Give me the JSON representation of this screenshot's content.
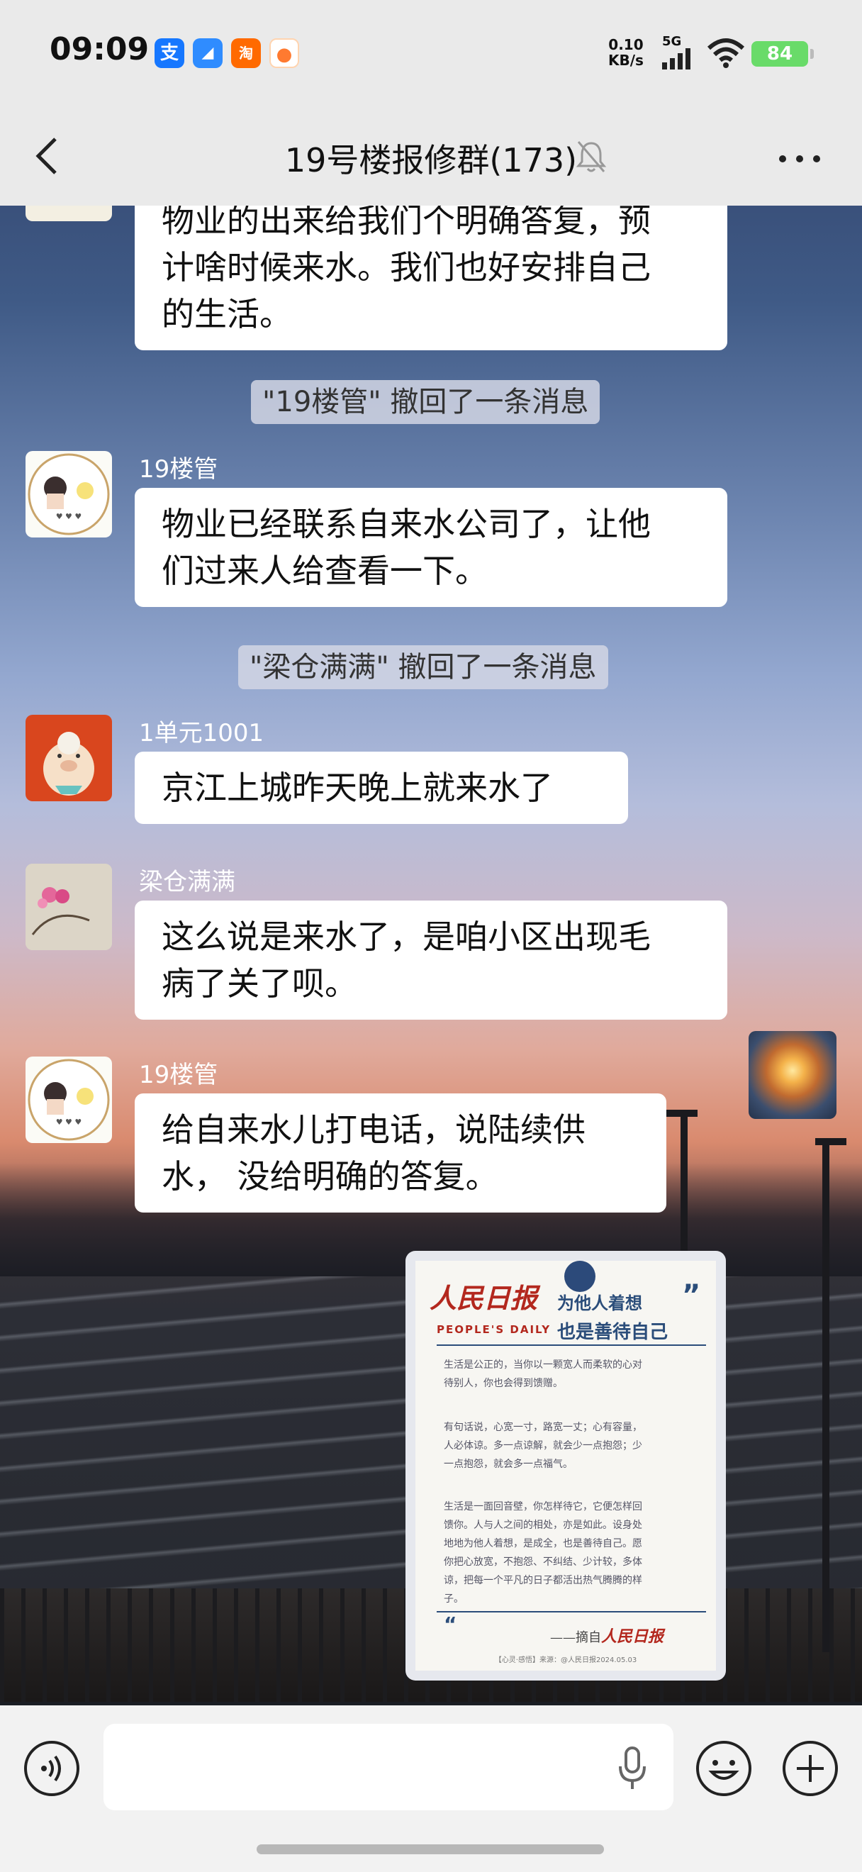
{
  "status_bar": {
    "time": "09:09",
    "net_speed_value": "0.10",
    "net_speed_unit": "KB/s",
    "network": "5G",
    "battery": "84",
    "apps": [
      {
        "icon": "alipay-icon",
        "glyph": "支",
        "color": "#1677ff"
      },
      {
        "icon": "browser-icon",
        "glyph": "◢",
        "color": "#2f8cff"
      },
      {
        "icon": "taobao-flash-icon",
        "glyph": "淘",
        "color": "#ff6a00"
      },
      {
        "icon": "game-app-icon",
        "glyph": "●",
        "color": "#ff7a30"
      }
    ]
  },
  "header": {
    "title": "19号楼报修群(173)"
  },
  "messages": [
    {
      "type": "text",
      "lines": [
        "物业的出来给我们个明确答复，预",
        "计啥时候来水。我们也好安排自己",
        "的生活。"
      ]
    },
    {
      "type": "notice",
      "text": "\"19楼管\" 撤回了一条消息"
    },
    {
      "type": "text",
      "sender": "19楼管",
      "lines": [
        "物业已经联系自来水公司了，让他",
        "们过来人给查看一下。"
      ]
    },
    {
      "type": "notice",
      "text": "\"梁仓满满\" 撤回了一条消息"
    },
    {
      "type": "text",
      "sender": "1单元1001",
      "lines": [
        "京江上城昨天晚上就来水了"
      ]
    },
    {
      "type": "text",
      "sender": "梁仓满满",
      "lines": [
        "这么说是来水了，是咱小区出现毛",
        "病了关了呗。"
      ]
    },
    {
      "type": "text",
      "sender": "19楼管",
      "lines": [
        "给自来水儿打电话，说陆续供",
        "水， 没给明确的答复。"
      ]
    }
  ],
  "card": {
    "brand": "人民日报",
    "brand_en": "PEOPLE'S DAILY",
    "title_line1": "为他人着想",
    "title_line2": "也是善待自己",
    "para1": [
      "生活是公正的，当你以一颗宽人而柔软的心对",
      "待别人，你也会得到馈赠。"
    ],
    "para2": [
      "有句话说，心宽一寸，路宽一丈；心有容量，",
      "人必体谅。多一点谅解，就会少一点抱怨；少",
      "一点抱怨，就会多一点福气。"
    ],
    "para3": [
      "生活是一面回音壁，你怎样待它，它便怎样回",
      "馈你。人与人之间的相处，亦是如此。设身处",
      "地地为他人着想，是成全，也是善待自己。愿",
      "你把心放宽，不抱怨、不纠结、少计较，多体",
      "谅，把每一个平凡的日子都活出热气腾腾的样",
      "子。"
    ],
    "signature_prefix": "——摘自",
    "signature_brand": "人民日报",
    "footer": "【心灵·感悟】来源：@人民日报2024.05.03"
  },
  "input": {
    "placeholder": ""
  }
}
